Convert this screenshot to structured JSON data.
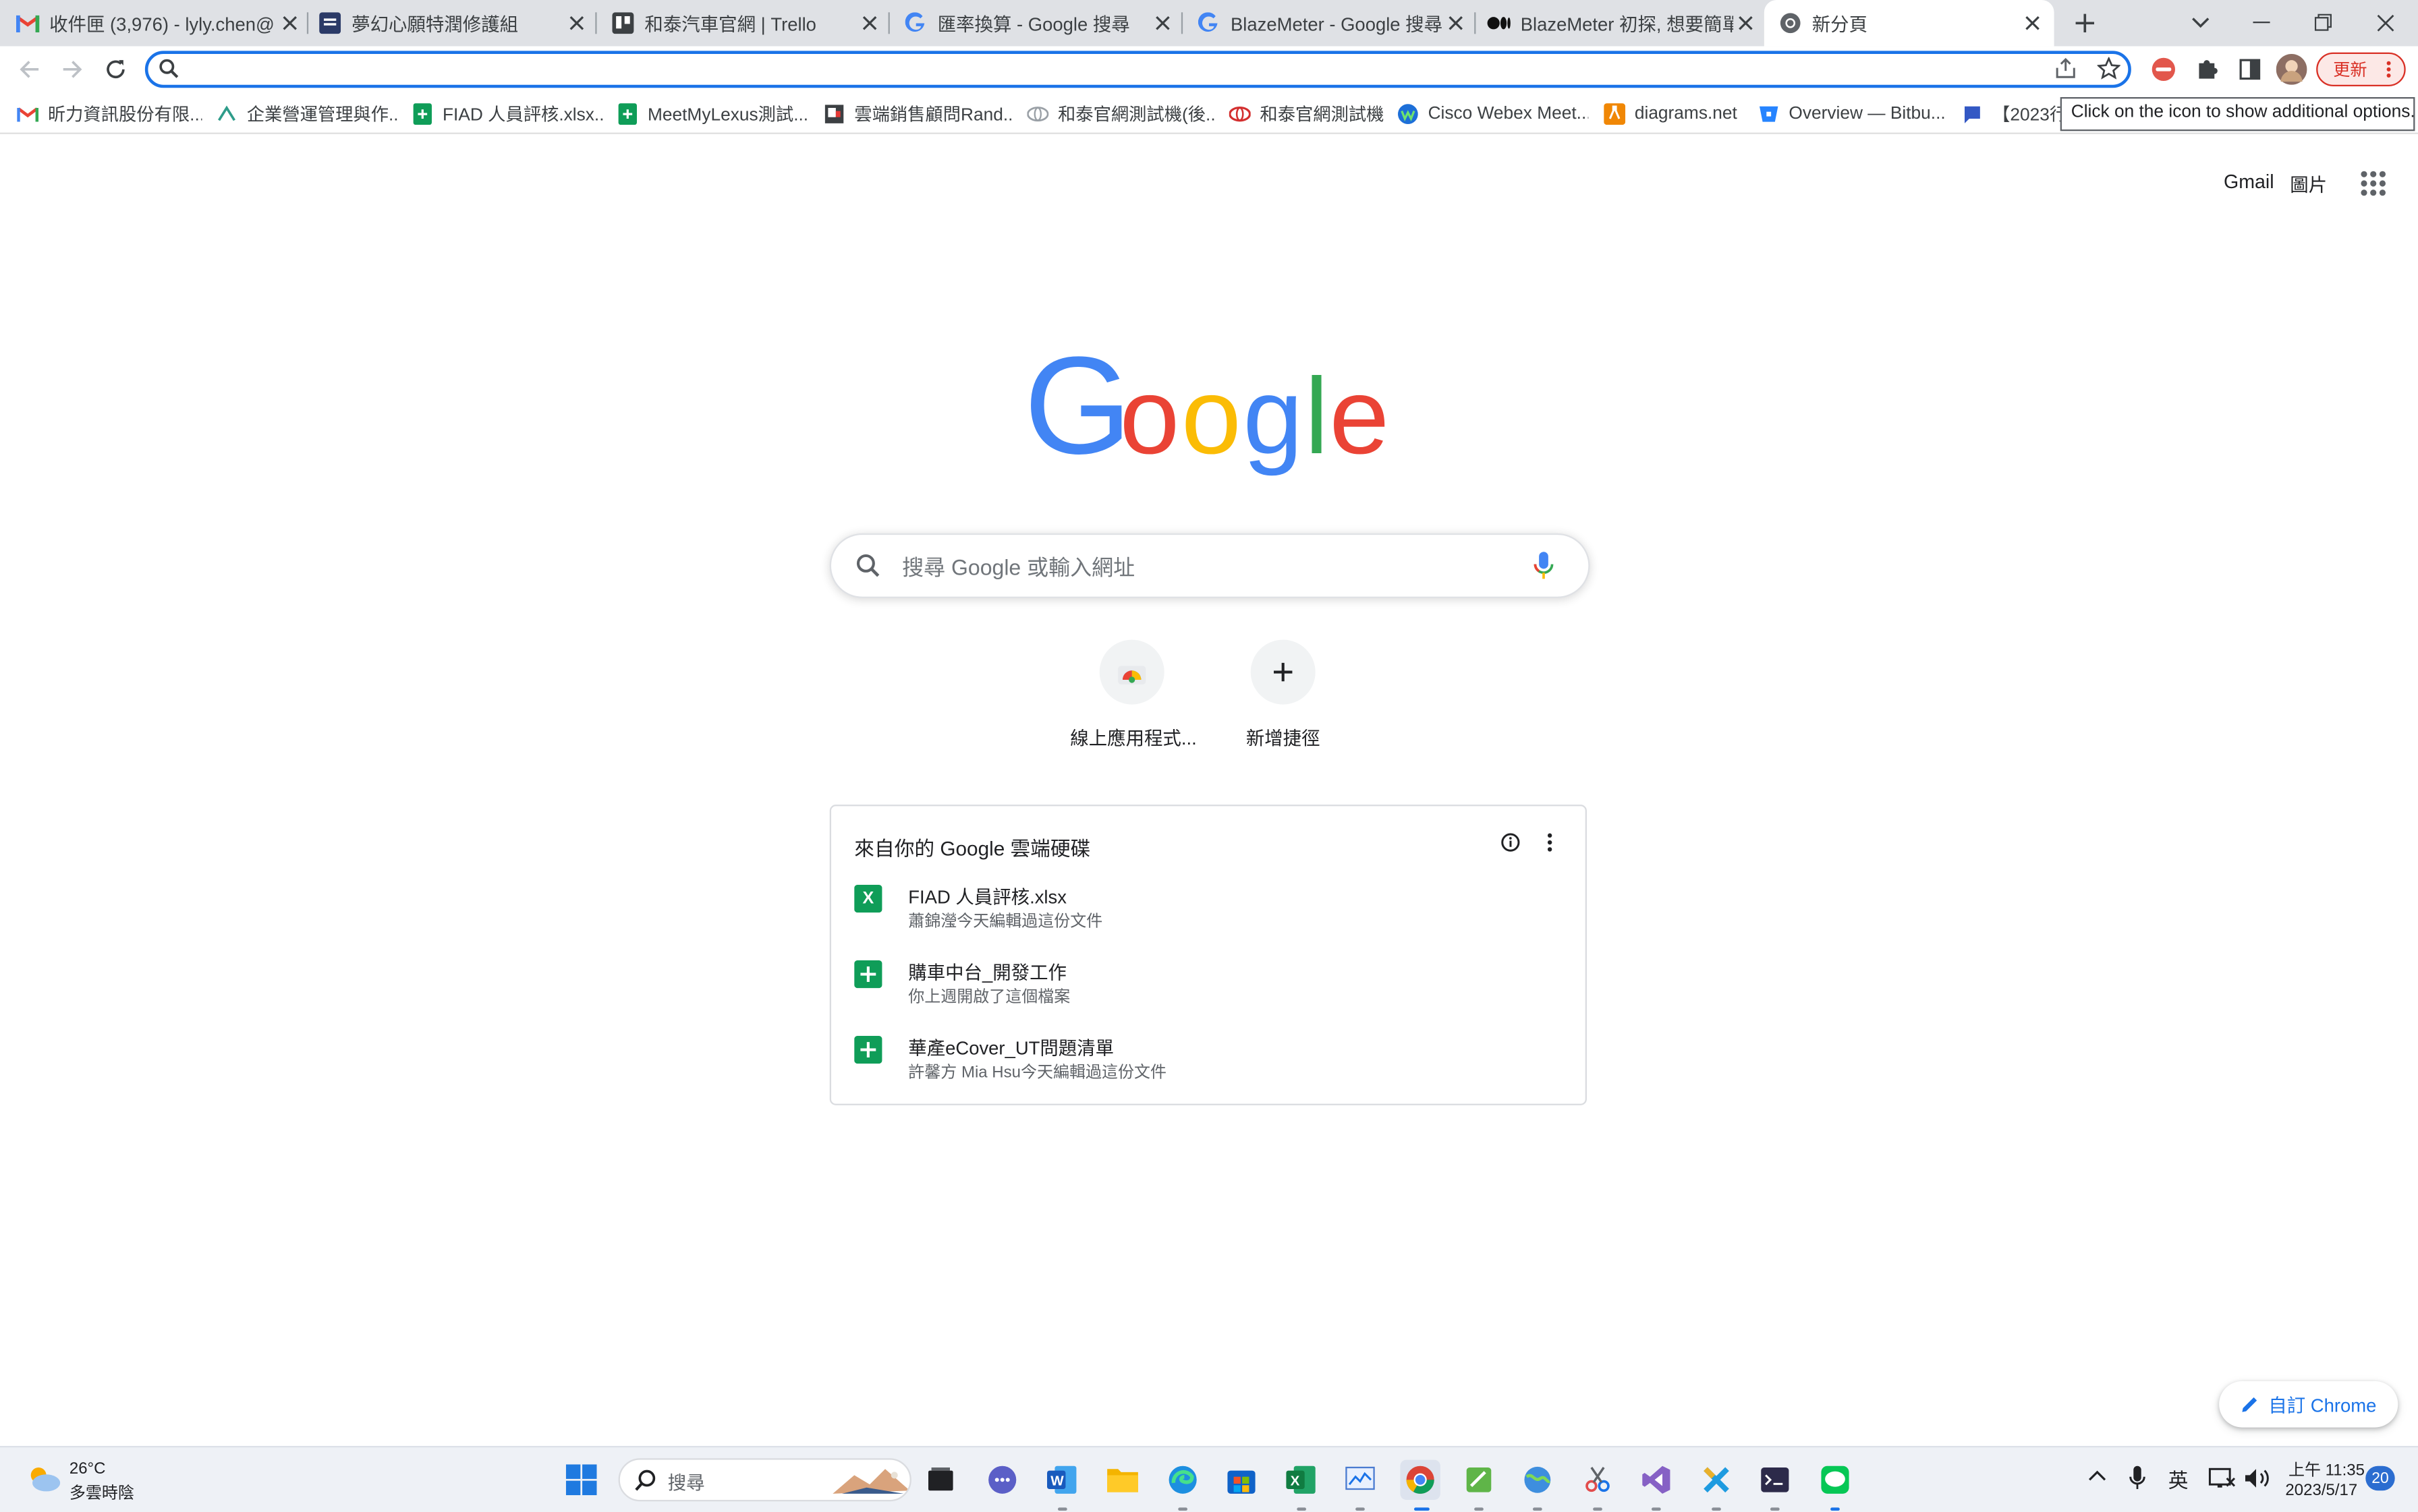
{
  "tabs": [
    {
      "title": "收件匣 (3,976) - lyly.chen@",
      "icon": "gmail-icon"
    },
    {
      "title": "夢幻心願特潤修護組",
      "icon": "site-icon"
    },
    {
      "title": "和泰汽車官網 | Trello",
      "icon": "trello-icon"
    },
    {
      "title": "匯率換算 - Google 搜尋",
      "icon": "google-icon"
    },
    {
      "title": "BlazeMeter - Google 搜尋",
      "icon": "google-icon"
    },
    {
      "title": "BlazeMeter 初探, 想要簡單",
      "icon": "medium-icon"
    },
    {
      "title": "新分頁",
      "icon": "chrome-icon"
    }
  ],
  "toolbar": {
    "omnibox_value": "",
    "update_label": "更新"
  },
  "bookmarks": [
    {
      "label": "昕力資訊股份有限...",
      "icon": "gmail-icon"
    },
    {
      "label": "企業營運管理與作...",
      "icon": "arrow-icon"
    },
    {
      "label": "FIAD 人員評核.xlsx...",
      "icon": "sheets-icon"
    },
    {
      "label": "MeetMyLexus測試...",
      "icon": "sheets-icon"
    },
    {
      "label": "雲端銷售顧問Rand...",
      "icon": "page-icon"
    },
    {
      "label": "和泰官網測試機(後...",
      "icon": "toyota-icon"
    },
    {
      "label": "和泰官網測試機",
      "icon": "toyota-icon"
    },
    {
      "label": "Cisco Webex Meet...",
      "icon": "webex-icon"
    },
    {
      "label": "diagrams.net",
      "icon": "drawio-icon"
    },
    {
      "label": "Overview — Bitbu...",
      "icon": "bitbucket-icon"
    },
    {
      "label": "【2023行",
      "icon": "chat-icon"
    }
  ],
  "tooltip": "Click on the icon to show additional options.",
  "header_links": {
    "gmail": "Gmail",
    "images": "圖片"
  },
  "search": {
    "placeholder": "搜尋 Google 或輸入網址"
  },
  "shortcuts": [
    {
      "label": "線上應用程式...",
      "icon": "web-store-icon"
    },
    {
      "label": "新增捷徑",
      "icon": "plus-icon"
    }
  ],
  "drive": {
    "title": "來自你的 Google 雲端硬碟",
    "items": [
      {
        "name": "FIAD 人員評核.xlsx",
        "detail": "蕭錦瀅今天編輯過這份文件",
        "icon": "excel-icon",
        "badge": "X"
      },
      {
        "name": "購車中台_開發工作",
        "detail": "你上週開啟了這個檔案",
        "icon": "sheets-icon"
      },
      {
        "name": "華產eCover_UT問題清單",
        "detail": "許馨方 Mia Hsu今天編輯過這份文件",
        "icon": "sheets-icon"
      }
    ]
  },
  "customize_label": "自訂 Chrome",
  "taskbar": {
    "weather_temp": "26°C",
    "weather_desc": "多雲時陰",
    "search_label": "搜尋",
    "ime": "英",
    "time": "上午 11:35",
    "date": "2023/5/17",
    "notifications": "20"
  },
  "colors": {
    "accent": "#1a73e8",
    "google_blue": "#4285f4",
    "google_red": "#ea4335",
    "google_yellow": "#fbbc05",
    "google_green": "#34a853",
    "update_red": "#d93025"
  }
}
